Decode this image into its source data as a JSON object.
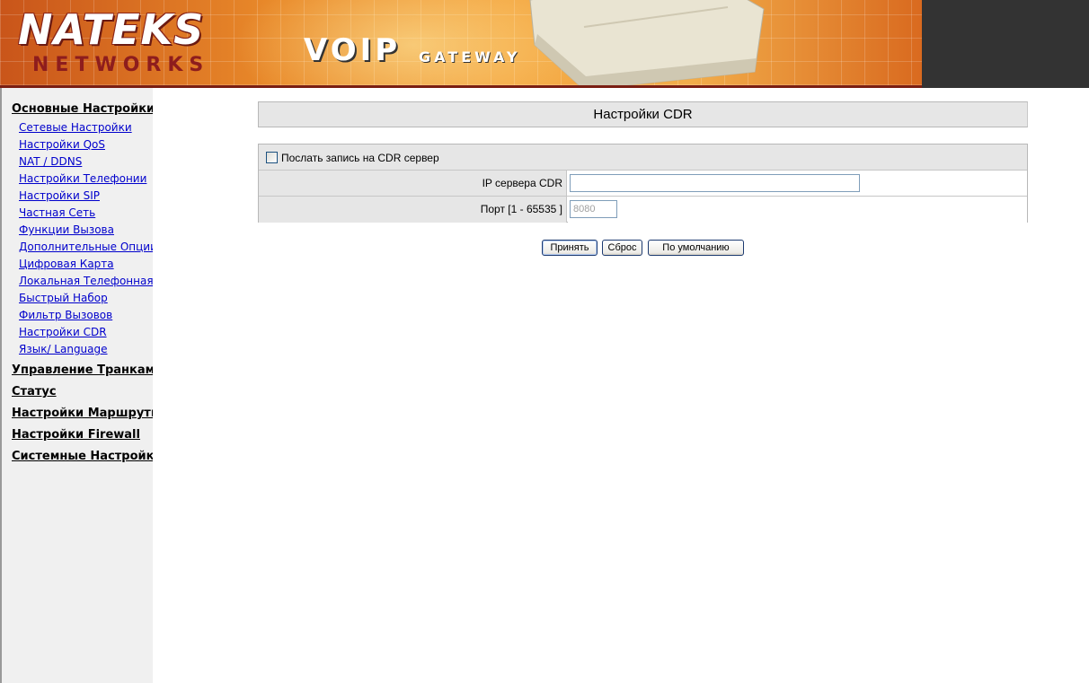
{
  "header": {
    "logo_top": "NATEKS",
    "logo_bottom": "NETWORKS",
    "product_main": "VOIP",
    "product_sub": "GATEWAY"
  },
  "sidebar": {
    "sections": [
      {
        "label": "Основные Настройки",
        "items": [
          {
            "label": "Сетевые Настройки"
          },
          {
            "label": "Настройки QoS"
          },
          {
            "label": "NAT / DDNS"
          },
          {
            "label": "Настройки Телефонии"
          },
          {
            "label": "Настройки SIP"
          },
          {
            "label": "Частная Сеть"
          },
          {
            "label": "Функции Вызова"
          },
          {
            "label": "Дополнительные Опции"
          },
          {
            "label": "Цифровая Карта"
          },
          {
            "label": "Локальная Телефонная К"
          },
          {
            "label": "Быстрый Набор"
          },
          {
            "label": "Фильтр Вызовов"
          },
          {
            "label": "Настройки CDR"
          },
          {
            "label": "Язык/ Language"
          }
        ]
      },
      {
        "label": "Управление Транкам"
      },
      {
        "label": "Статус"
      },
      {
        "label": "Настройки Маршрути"
      },
      {
        "label": "Настройки Firewall"
      },
      {
        "label": "Системные Настройк"
      }
    ]
  },
  "main": {
    "title": "Настройки CDR",
    "form": {
      "send_checkbox_label": "Послать запись на CDR сервер",
      "send_checked": false,
      "ip_label": "IP сервера CDR",
      "ip_value": "",
      "port_label": "Порт [1 - 65535 ]",
      "port_value": "8080"
    },
    "buttons": {
      "accept": "Принять",
      "reset": "Сброс",
      "default": "По умолчанию"
    }
  },
  "colors": {
    "link": "#0000cc",
    "panel_bg": "#e6e6e6",
    "sidebar_bg": "#f0f0f0",
    "header_dark": "#333333",
    "banner_orange": "#f4a640"
  }
}
